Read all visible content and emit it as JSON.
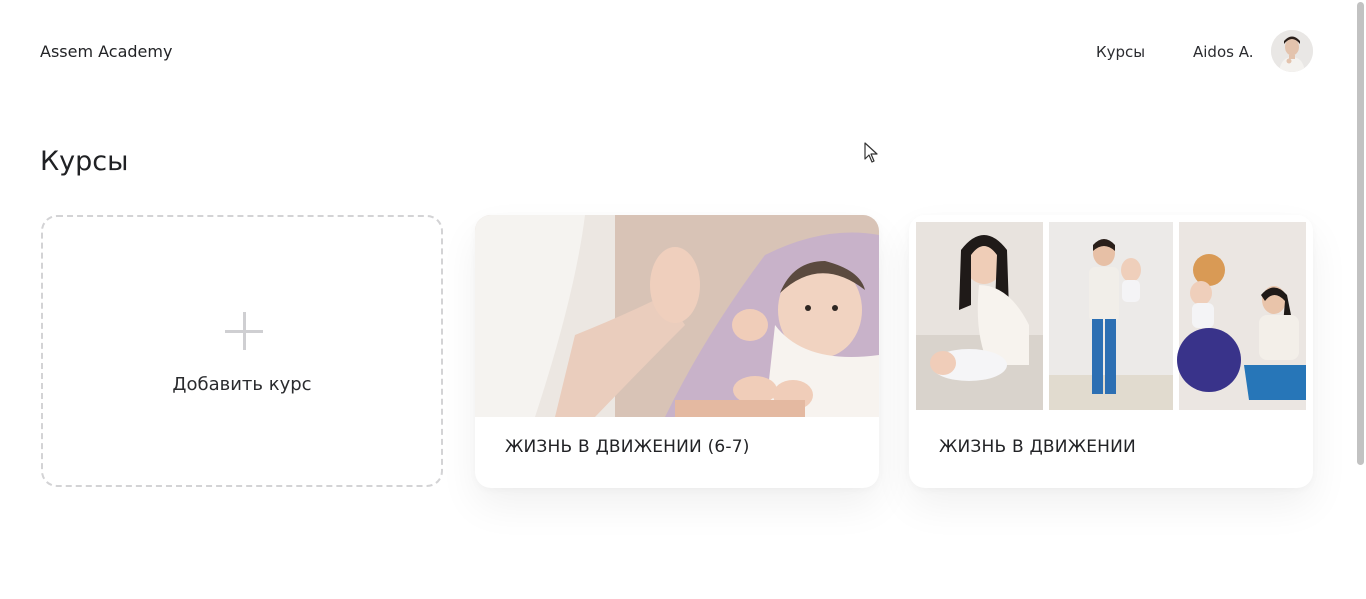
{
  "header": {
    "brand": "Assem Academy",
    "nav_courses": "Курсы",
    "user_name": "Aidos A."
  },
  "main": {
    "title": "Курсы",
    "add_card": {
      "label": "Добавить курс",
      "icon": "plus-icon"
    },
    "courses": [
      {
        "title": "ЖИЗНЬ В ДВИЖЕНИИ (6-7)"
      },
      {
        "title": "ЖИЗНЬ В ДВИЖЕНИИ"
      }
    ]
  },
  "colors": {
    "text": "#222326",
    "dashed_border": "#d3d3d5",
    "plus": "#cfcfd2",
    "background": "#ffffff"
  }
}
